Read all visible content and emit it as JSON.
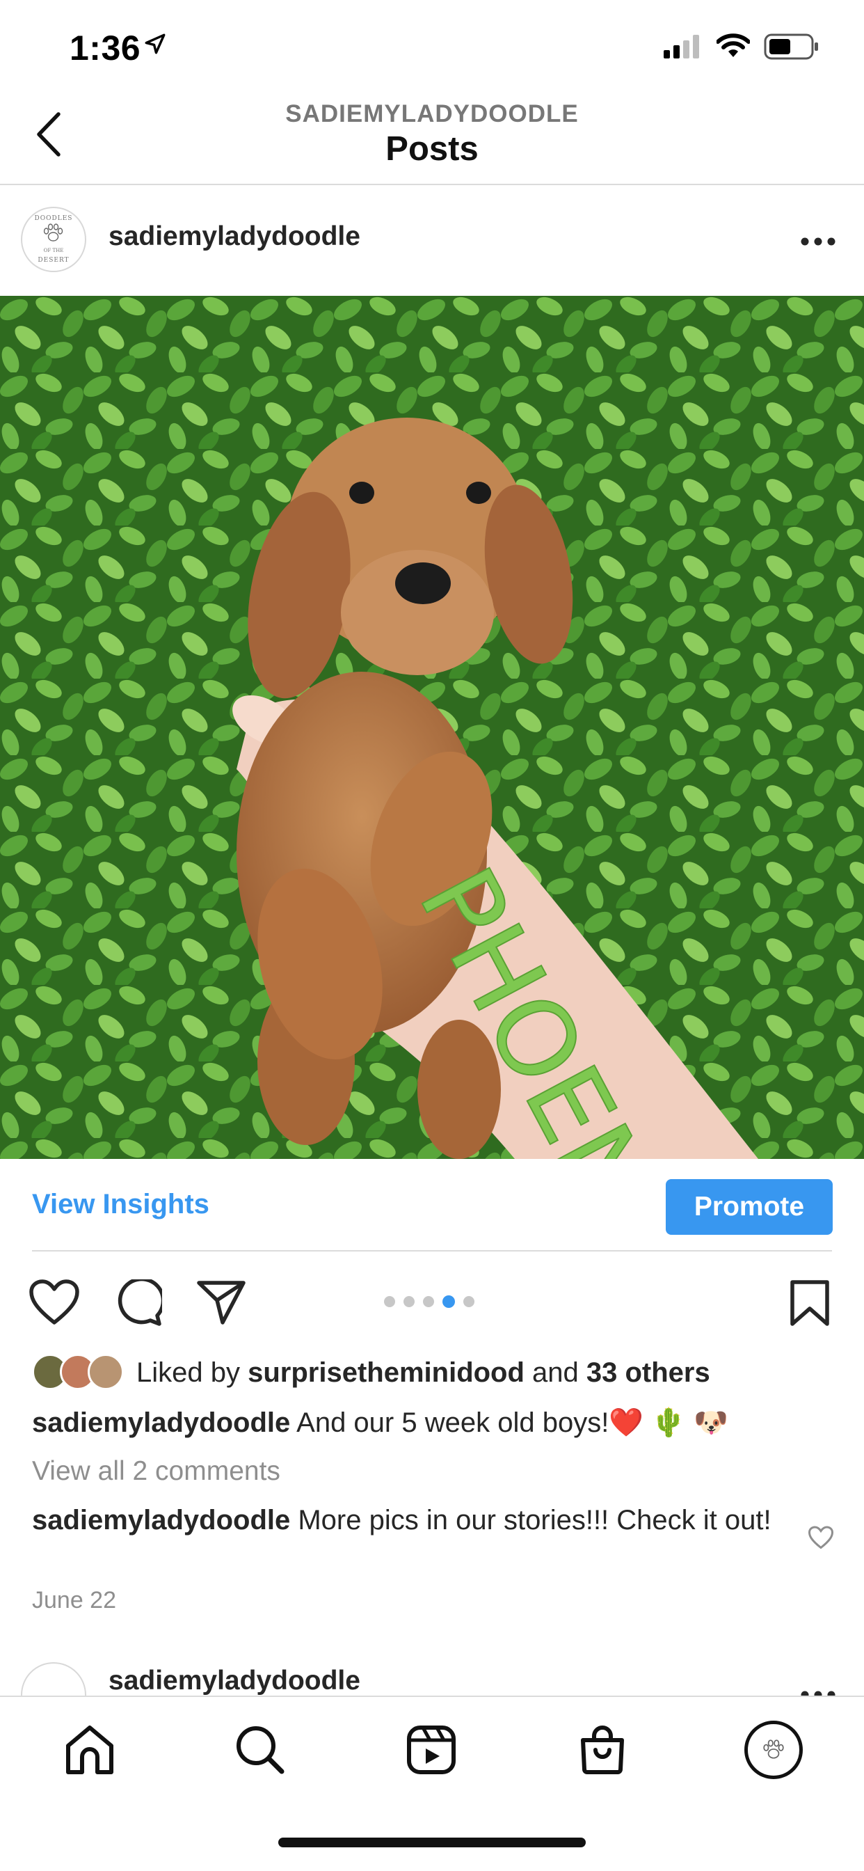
{
  "status_bar": {
    "time": "1:36"
  },
  "header": {
    "subtitle": "SADIEMYLADYDOODLE",
    "title": "Posts"
  },
  "post": {
    "username": "sadiemyladydoodle",
    "avatar_text": [
      "DOODLES",
      "OF THE",
      "DESERT"
    ],
    "image_caption_overlay": "PHOENIX",
    "insights_label": "View Insights",
    "promote_label": "Promote",
    "carousel": {
      "count": 5,
      "active_index": 3
    },
    "likes": {
      "prefix": "Liked by ",
      "user": "surprisetheminidood",
      "middle": " and ",
      "others": "33 others"
    },
    "caption": {
      "user": "sadiemyladydoodle",
      "text": " And our 5 week old boys!❤️ 🌵 🐶"
    },
    "view_comments": "View all 2 comments",
    "comment": {
      "user": "sadiemyladydoodle",
      "text": " More pics in our stories!!! Check it out!"
    },
    "date": "June 22"
  },
  "next_post": {
    "username": "sadiemyladydoodle"
  },
  "tabbar": {
    "items": [
      "home-icon",
      "search-icon",
      "reels-icon",
      "shop-icon",
      "profile-avatar"
    ]
  },
  "colors": {
    "accent": "#3897f0",
    "text": "#262626",
    "muted": "#8e8e8e",
    "divider": "#dbdbdb"
  }
}
